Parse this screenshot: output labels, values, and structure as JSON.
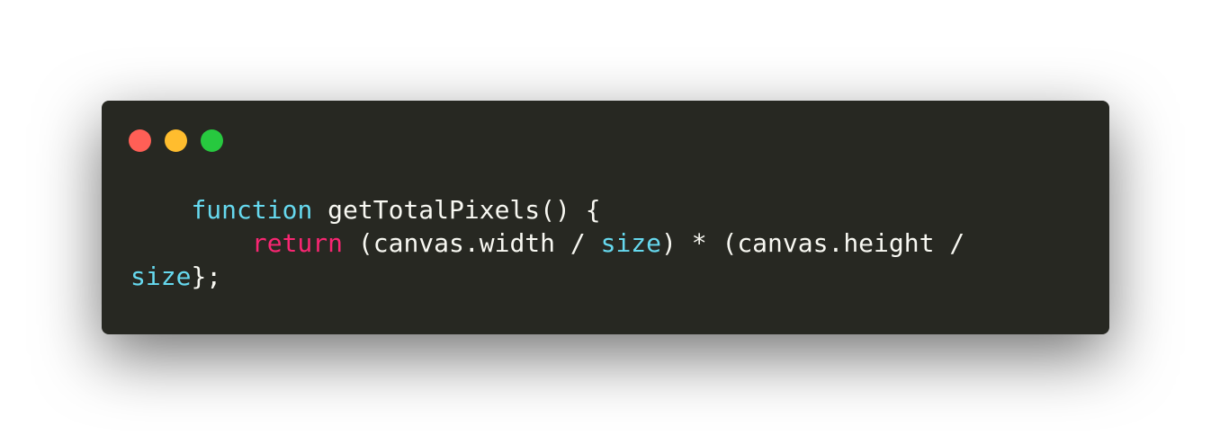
{
  "window": {
    "background": "#272822",
    "controls": [
      {
        "name": "close",
        "color": "#ff5f56"
      },
      {
        "name": "minimize",
        "color": "#ffbd2e"
      },
      {
        "name": "maximize",
        "color": "#27c93f"
      }
    ]
  },
  "code": {
    "line1": {
      "indent": "    ",
      "keyword": "function",
      "rest": " getTotalPixels() {"
    },
    "line2": {
      "indent": "        ",
      "keyword": "return",
      "part1": " (canvas.width / ",
      "var1": "size",
      "part2": ") * (canvas.height /"
    },
    "line3": {
      "var": "size",
      "rest": "};"
    }
  },
  "colors": {
    "text": "#f8f8f2",
    "keyword_function": "#66d9ef",
    "keyword_return": "#f92672",
    "identifier_size": "#66d9ef"
  }
}
